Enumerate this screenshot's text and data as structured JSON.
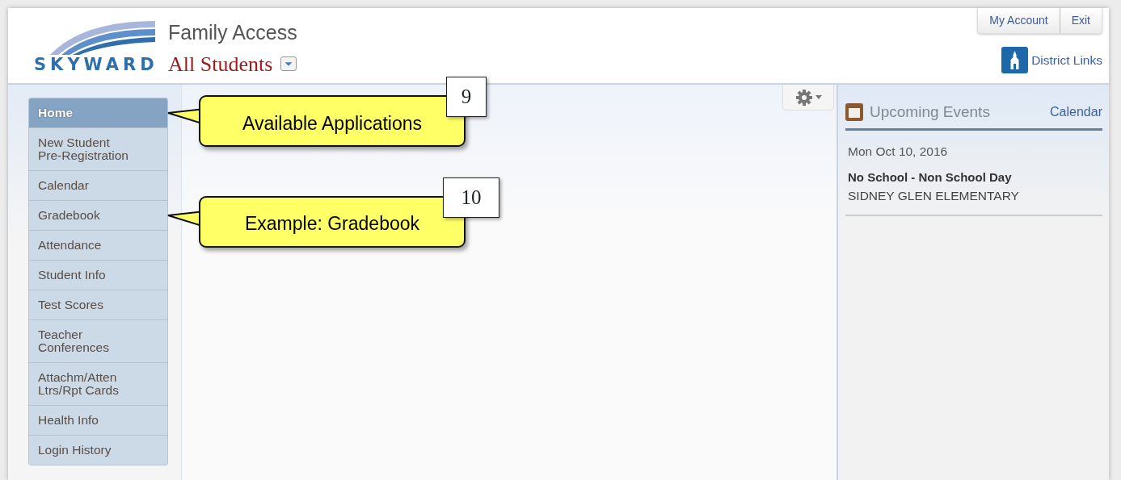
{
  "header": {
    "logo": "SKYWARD",
    "app_title": "Family Access",
    "student_selector": "All Students",
    "account_links": [
      "My Account",
      "Exit"
    ],
    "district_links": "District Links"
  },
  "sidebar": {
    "items": [
      {
        "label": "Home",
        "selected": true
      },
      {
        "label": "New Student\nPre-Registration",
        "selected": false
      },
      {
        "label": "Calendar",
        "selected": false
      },
      {
        "label": "Gradebook",
        "selected": false
      },
      {
        "label": "Attendance",
        "selected": false
      },
      {
        "label": "Student Info",
        "selected": false
      },
      {
        "label": "Test Scores",
        "selected": false
      },
      {
        "label": "Teacher\nConferences",
        "selected": false
      },
      {
        "label": "Attachm/Atten\nLtrs/Rpt Cards",
        "selected": false
      },
      {
        "label": "Health Info",
        "selected": false
      },
      {
        "label": "Login History",
        "selected": false
      }
    ]
  },
  "callouts": [
    {
      "number": "9",
      "text": "Available Applications"
    },
    {
      "number": "10",
      "text": "Example: Gradebook"
    }
  ],
  "upcoming_events": {
    "title": "Upcoming Events",
    "link": "Calendar",
    "date": "Mon Oct 10, 2016",
    "events": [
      {
        "title": "No School - Non School Day",
        "location": "SIDNEY GLEN ELEMENTARY"
      }
    ]
  }
}
